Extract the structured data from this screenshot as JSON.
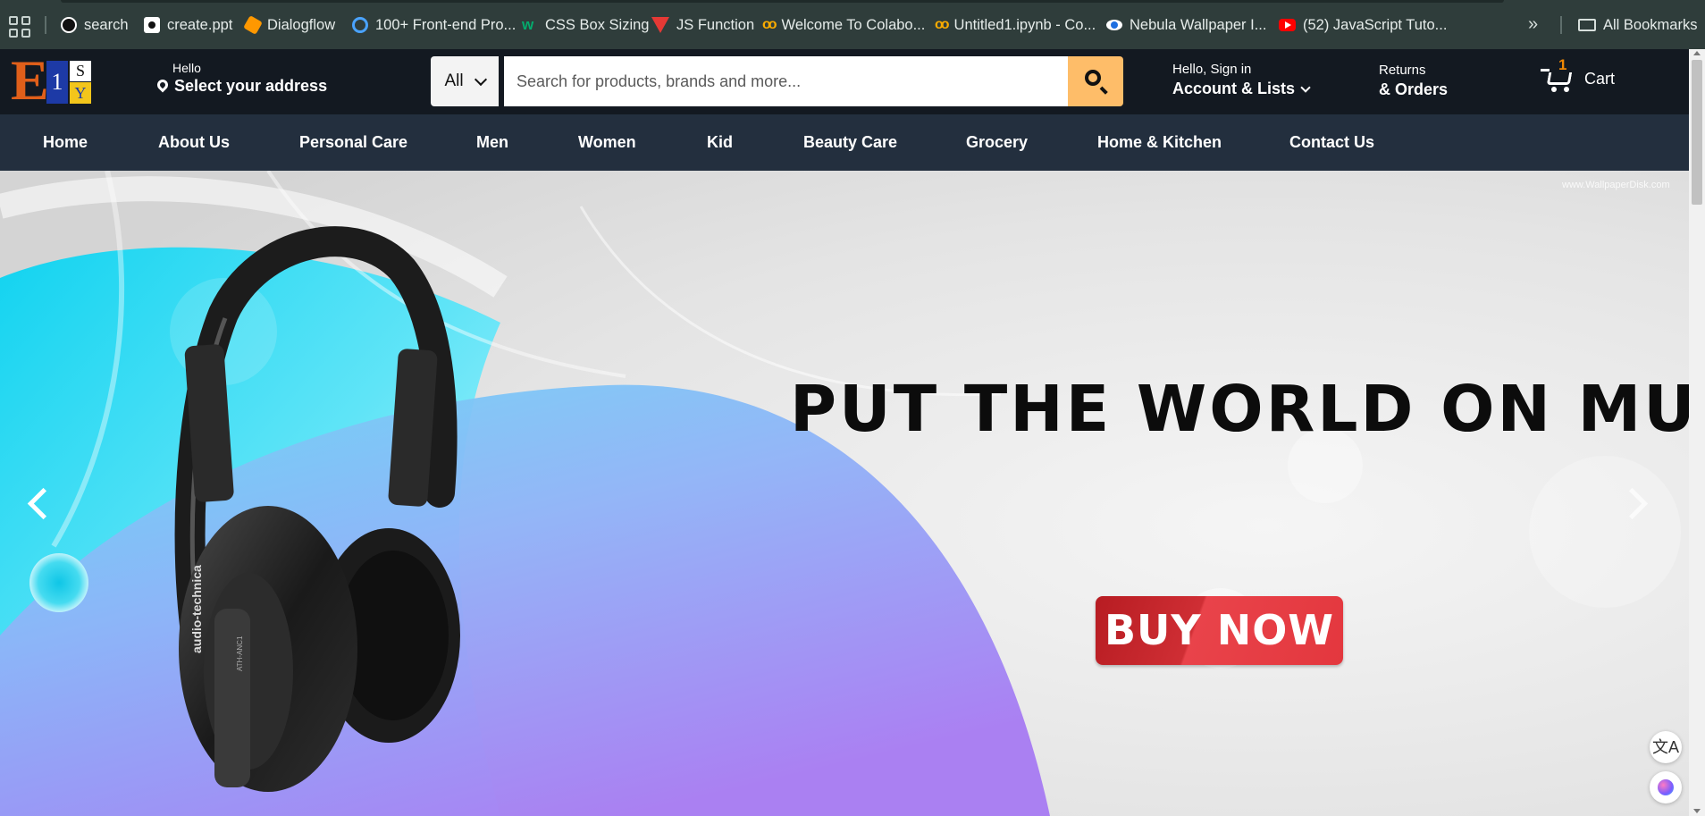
{
  "bookmarks": {
    "items": [
      {
        "label": "search",
        "icon": "openai-icon",
        "color": "#ffffff"
      },
      {
        "label": "create.ppt",
        "icon": "camera-icon",
        "color": "#ffffff"
      },
      {
        "label": "Dialogflow",
        "icon": "dialogflow-icon",
        "color": "#ff9800"
      },
      {
        "label": "100+ Front-end Pro...",
        "icon": "github-icon",
        "color": "#4aa3ff"
      },
      {
        "label": "CSS Box Sizing",
        "icon": "w3schools-icon",
        "color": "#04aa6d"
      },
      {
        "label": "JS Function",
        "icon": "jsfunction-icon",
        "color": "#e53935"
      },
      {
        "label": "Welcome To Colabo...",
        "icon": "colab-icon",
        "color": "#f9ab00"
      },
      {
        "label": "Untitled1.ipynb - Co...",
        "icon": "colab-icon",
        "color": "#f9ab00"
      },
      {
        "label": "Nebula Wallpaper I...",
        "icon": "eye-icon",
        "color": "#1e6fe0"
      },
      {
        "label": "(52) JavaScript Tuto...",
        "icon": "youtube-icon",
        "color": "#ff0000"
      }
    ],
    "more": "»",
    "all_bookmarks": "All Bookmarks"
  },
  "header": {
    "logo": {
      "e": "E",
      "middle": "1",
      "s": "S",
      "y": "Y"
    },
    "address_hello": "Hello",
    "address_main": "Select your address",
    "search": {
      "category": "All",
      "placeholder": "Search for products, brands and more..."
    },
    "account_hello": "Hello, Sign in",
    "account_main": "Account & Lists",
    "returns": "Returns",
    "orders": "& Orders",
    "cart_count": "1",
    "cart_label": "Cart"
  },
  "nav": [
    "Home",
    "About Us",
    "Personal Care",
    "Men",
    "Women",
    "Kid",
    "Beauty Care",
    "Grocery",
    "Home & Kitchen",
    "Contact Us"
  ],
  "hero": {
    "watermark": "www.WallpaperDisk.com",
    "headline": "PUT THE WORLD ON MUTE",
    "cta": "BUY NOW",
    "brand_text": "audio-technica",
    "model_text": "ATH-ANC1"
  },
  "fab": {
    "translate": "文A"
  },
  "colors": {
    "header_bg": "#131921",
    "nav_bg": "#232f3e",
    "search_button": "#febd69",
    "cta": "#e3373e",
    "logo_orange": "#e05f1a"
  }
}
